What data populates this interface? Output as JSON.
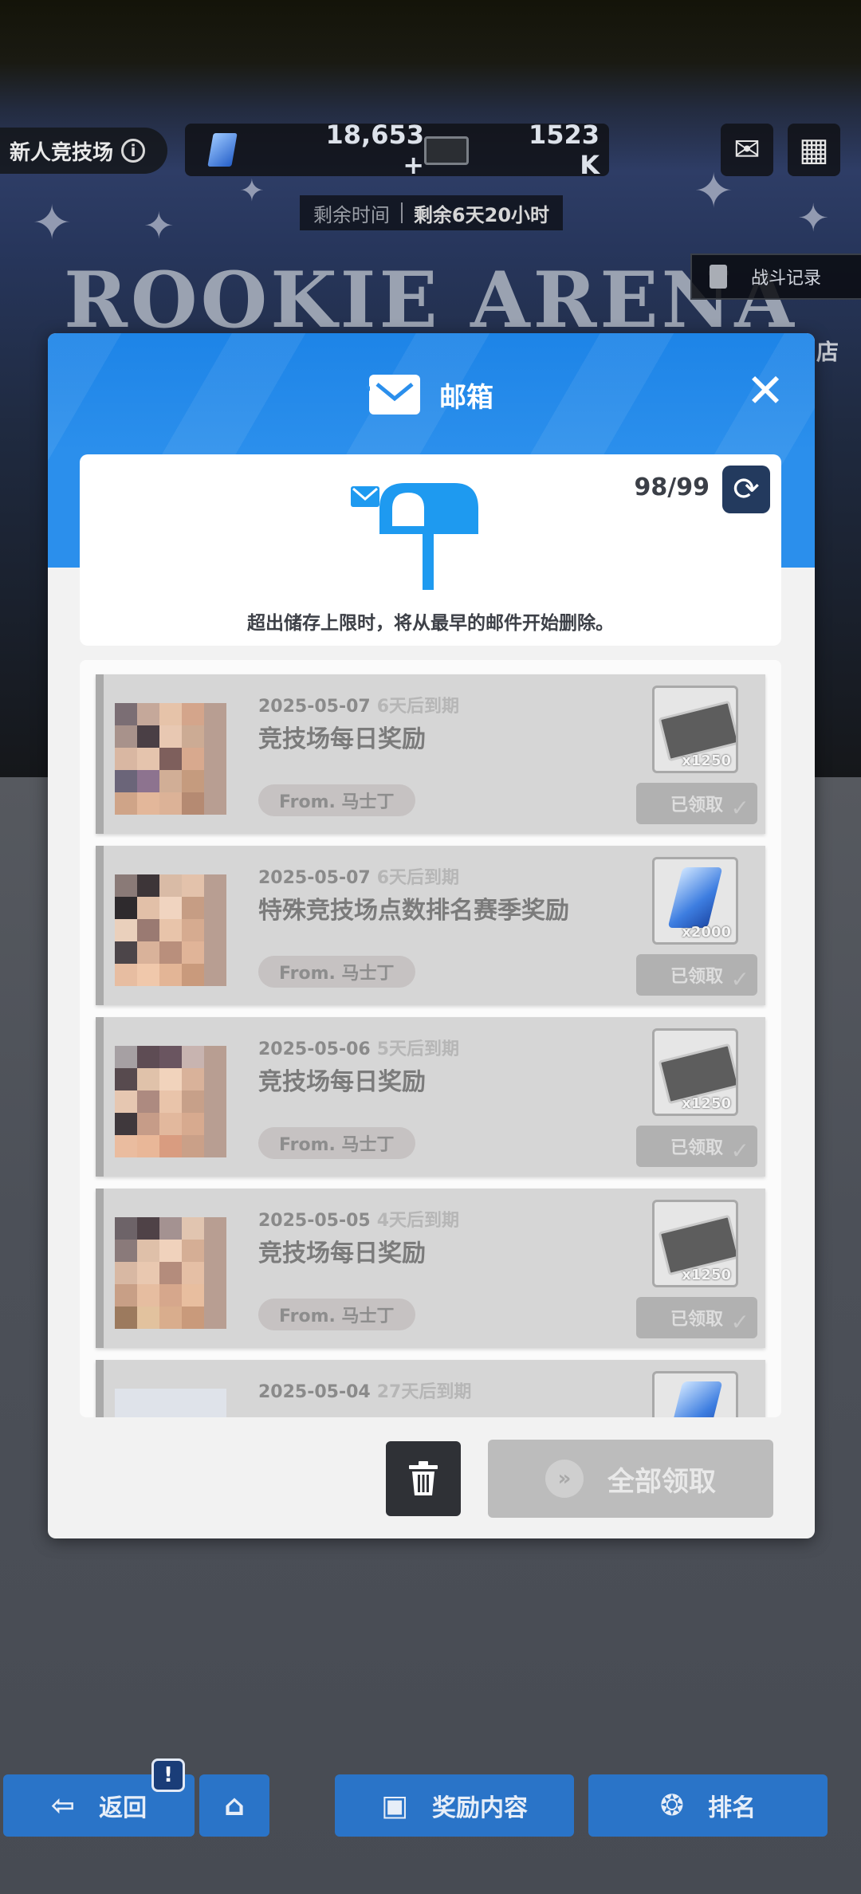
{
  "top": {
    "arena_name": "新人竞技场",
    "gems": "18,653",
    "gems_plus": "+",
    "tickets": "1523 K",
    "remaining_label": "剩余时间",
    "remaining_value": "剩余6天20小时",
    "arena_title": "ROOKIE ARENA",
    "battle_record": "战斗记录",
    "shop_partial": "店"
  },
  "modal": {
    "title": "邮箱",
    "counter": "98/99",
    "notice": "超出储存上限时，将从最早的邮件开始删除。",
    "claim_all": "全部领取",
    "mails": [
      {
        "date": "2025-05-07",
        "expire": "6天后到期",
        "title": "竞技场每日奖励",
        "from": "From. 马士丁",
        "reward": "ticket",
        "count": "x1250",
        "status": "已领取"
      },
      {
        "date": "2025-05-07",
        "expire": "6天后到期",
        "title": "特殊竞技场点数排名赛季奖励",
        "from": "From. 马士丁",
        "reward": "gem",
        "count": "x2000",
        "status": "已领取"
      },
      {
        "date": "2025-05-06",
        "expire": "5天后到期",
        "title": "竞技场每日奖励",
        "from": "From. 马士丁",
        "reward": "ticket",
        "count": "x1250",
        "status": "已领取"
      },
      {
        "date": "2025-05-05",
        "expire": "4天后到期",
        "title": "竞技场每日奖励",
        "from": "From. 马士丁",
        "reward": "ticket",
        "count": "x1250",
        "status": "已领取"
      },
      {
        "date": "2025-05-04",
        "expire": "27天后到期",
        "title": "",
        "from": "",
        "reward": "gem",
        "count": "",
        "status": ""
      }
    ]
  },
  "nav": {
    "back": "返回",
    "badge": "!",
    "rewards": "奖励内容",
    "ranking": "排名"
  },
  "colors": {
    "modal_header": "#2b8fec",
    "claimed_button": "#b1b1b1",
    "nav_button": "#2a74c8"
  }
}
